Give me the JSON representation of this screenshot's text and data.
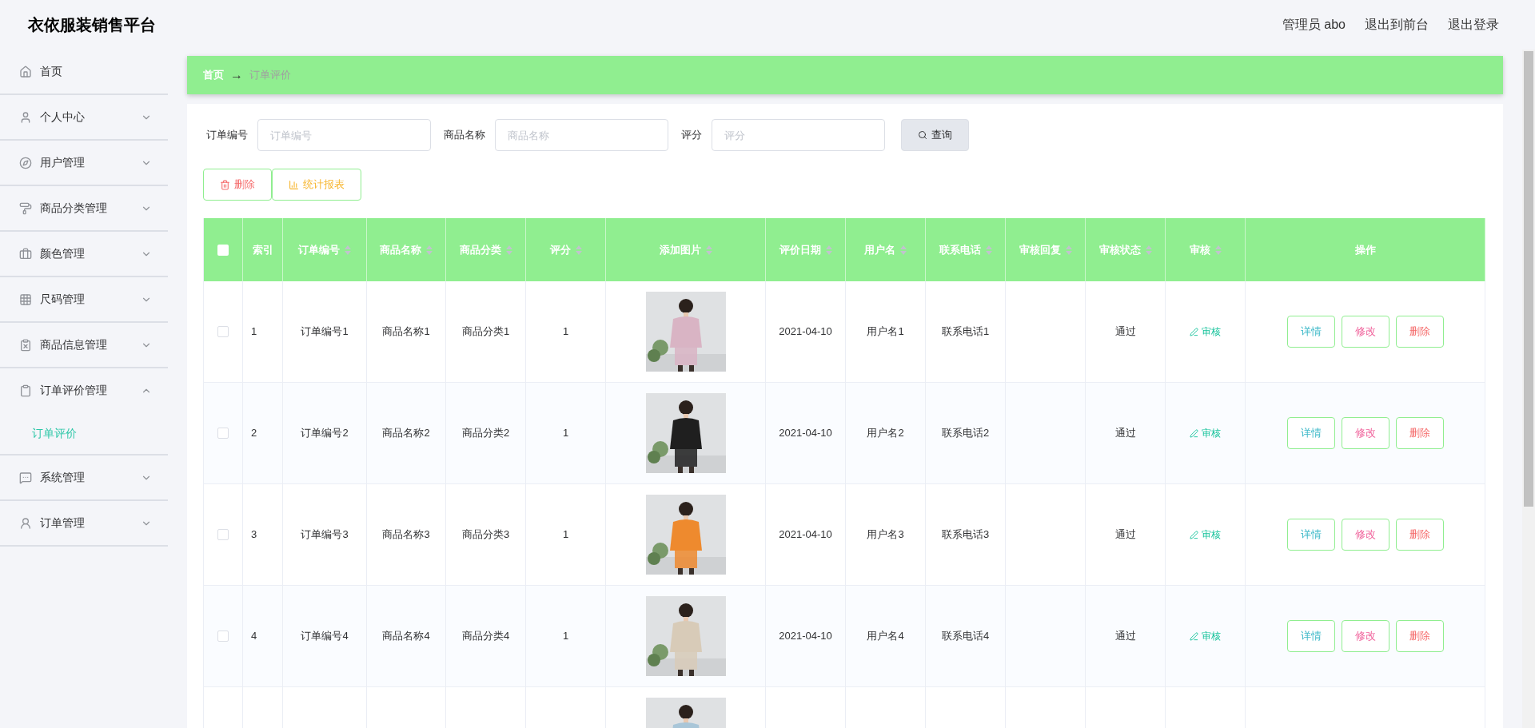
{
  "header": {
    "title": "衣依服装销售平台",
    "links": [
      "管理员 abo",
      "退出到前台",
      "退出登录"
    ]
  },
  "sidebar": {
    "items": [
      {
        "label": "首页"
      },
      {
        "label": "个人中心",
        "expanded": false
      },
      {
        "label": "用户管理",
        "expanded": false
      },
      {
        "label": "商品分类管理",
        "expanded": false
      },
      {
        "label": "颜色管理",
        "expanded": false
      },
      {
        "label": "尺码管理",
        "expanded": false
      },
      {
        "label": "商品信息管理",
        "expanded": false
      },
      {
        "label": "订单评价管理",
        "expanded": true,
        "children": [
          {
            "label": "订单评价",
            "selected": true
          }
        ]
      },
      {
        "label": "系统管理",
        "expanded": false
      },
      {
        "label": "订单管理",
        "expanded": false
      }
    ]
  },
  "breadcrumb": {
    "home": "首页",
    "arrow": "→",
    "current": "订单评价"
  },
  "search": {
    "fields": [
      {
        "label": "订单编号",
        "placeholder": "订单编号"
      },
      {
        "label": "商品名称",
        "placeholder": "商品名称"
      },
      {
        "label": "评分",
        "placeholder": "评分"
      }
    ],
    "button": "查询"
  },
  "actions": [
    {
      "kind": "delete",
      "label": "删除"
    },
    {
      "kind": "report",
      "label": "统计报表"
    }
  ],
  "table": {
    "columns": [
      {
        "kind": "checkbox",
        "checked": false
      },
      {
        "label": "索引",
        "sortable": false
      },
      {
        "label": "订单编号",
        "sortable": true
      },
      {
        "label": "商品名称",
        "sortable": true
      },
      {
        "label": "商品分类",
        "sortable": true
      },
      {
        "label": "评分",
        "sortable": true
      },
      {
        "label": "添加图片",
        "sortable": true
      },
      {
        "label": "评价日期",
        "sortable": true
      },
      {
        "label": "用户名",
        "sortable": true
      },
      {
        "label": "联系电话",
        "sortable": true
      },
      {
        "label": "审核回复",
        "sortable": true
      },
      {
        "label": "审核状态",
        "sortable": true
      },
      {
        "label": "审核",
        "sortable": true
      },
      {
        "label": "操作",
        "sortable": false
      }
    ],
    "rows": [
      {
        "checked": false,
        "index": "1",
        "order_no": "订单编号1",
        "product_name": "商品名称1",
        "category": "商品分类1",
        "rating": "1",
        "date": "2021-04-10",
        "username": "用户名1",
        "phone": "联系电话1",
        "status": "通过",
        "review": "审核",
        "buttons": [
          "详情",
          "修改",
          "删除"
        ]
      },
      {
        "checked": false,
        "index": "2",
        "order_no": "订单编号2",
        "product_name": "商品名称2",
        "category": "商品分类2",
        "rating": "1",
        "date": "2021-04-10",
        "username": "用户名2",
        "phone": "联系电话2",
        "status": "通过",
        "review": "审核",
        "buttons": [
          "详情",
          "修改",
          "删除"
        ]
      },
      {
        "checked": false,
        "index": "3",
        "order_no": "订单编号3",
        "product_name": "商品名称3",
        "category": "商品分类3",
        "rating": "1",
        "date": "2021-04-10",
        "username": "用户名3",
        "phone": "联系电话3",
        "status": "通过",
        "review": "审核",
        "buttons": [
          "详情",
          "修改",
          "删除"
        ]
      },
      {
        "checked": false,
        "index": "4",
        "order_no": "订单编号4",
        "product_name": "商品名称4",
        "category": "商品分类4",
        "rating": "1",
        "date": "2021-04-10",
        "username": "用户名4",
        "phone": "联系电话4",
        "status": "通过",
        "review": "审核",
        "buttons": [
          "详情",
          "修改",
          "删除"
        ]
      }
    ]
  }
}
